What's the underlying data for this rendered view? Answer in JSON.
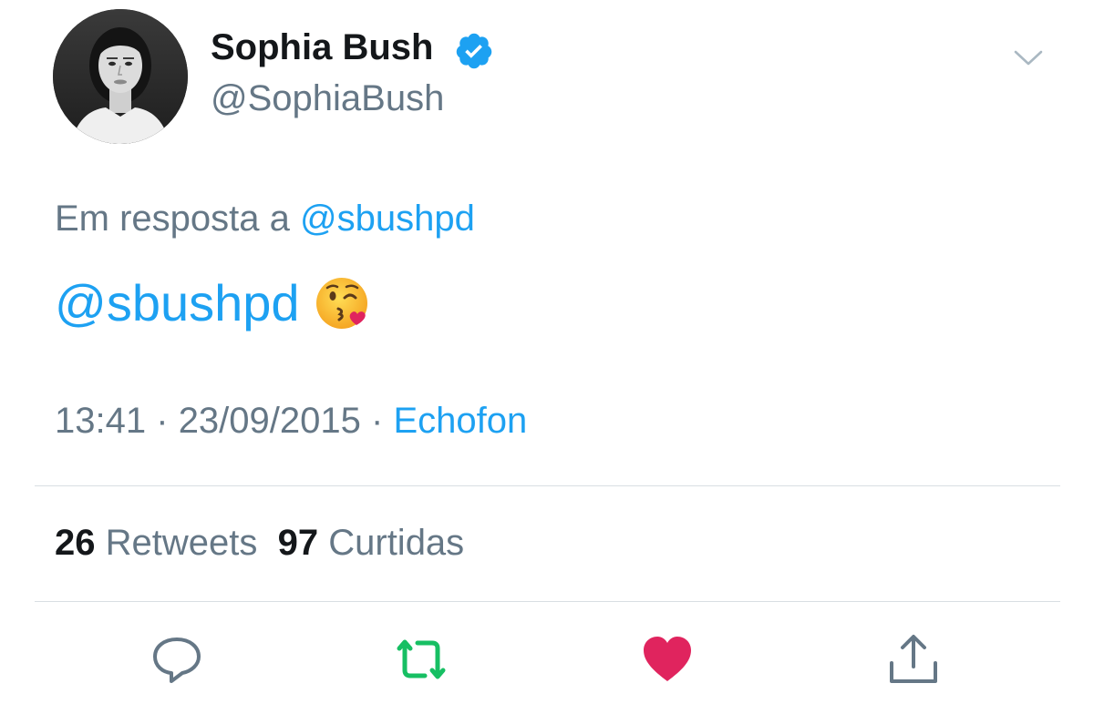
{
  "user": {
    "display_name": "Sophia Bush",
    "handle": "@SophiaBush",
    "verified": true
  },
  "tweet": {
    "reply_prefix": "Em resposta a",
    "reply_to": "@sbushpd",
    "text_mention": "@sbushpd",
    "emoji": "face-throwing-kiss",
    "time": "13:41",
    "date": "23/09/2015",
    "separator": "·",
    "source": "Echofon"
  },
  "stats": {
    "retweets_count": "26",
    "retweets_label": "Retweets",
    "likes_count": "97",
    "likes_label": "Curtidas"
  },
  "actions": [
    {
      "icon": "reply-icon",
      "color": "#657786"
    },
    {
      "icon": "retweet-icon",
      "color": "#17bf63"
    },
    {
      "icon": "heart-icon",
      "color": "#e0245e"
    },
    {
      "icon": "share-icon",
      "color": "#657786"
    }
  ],
  "colors": {
    "link": "#1da1f2",
    "secondary_text": "#657786",
    "primary_text": "#14171a",
    "retweeted": "#17bf63",
    "liked": "#e0245e",
    "divider": "#d9dee2"
  }
}
